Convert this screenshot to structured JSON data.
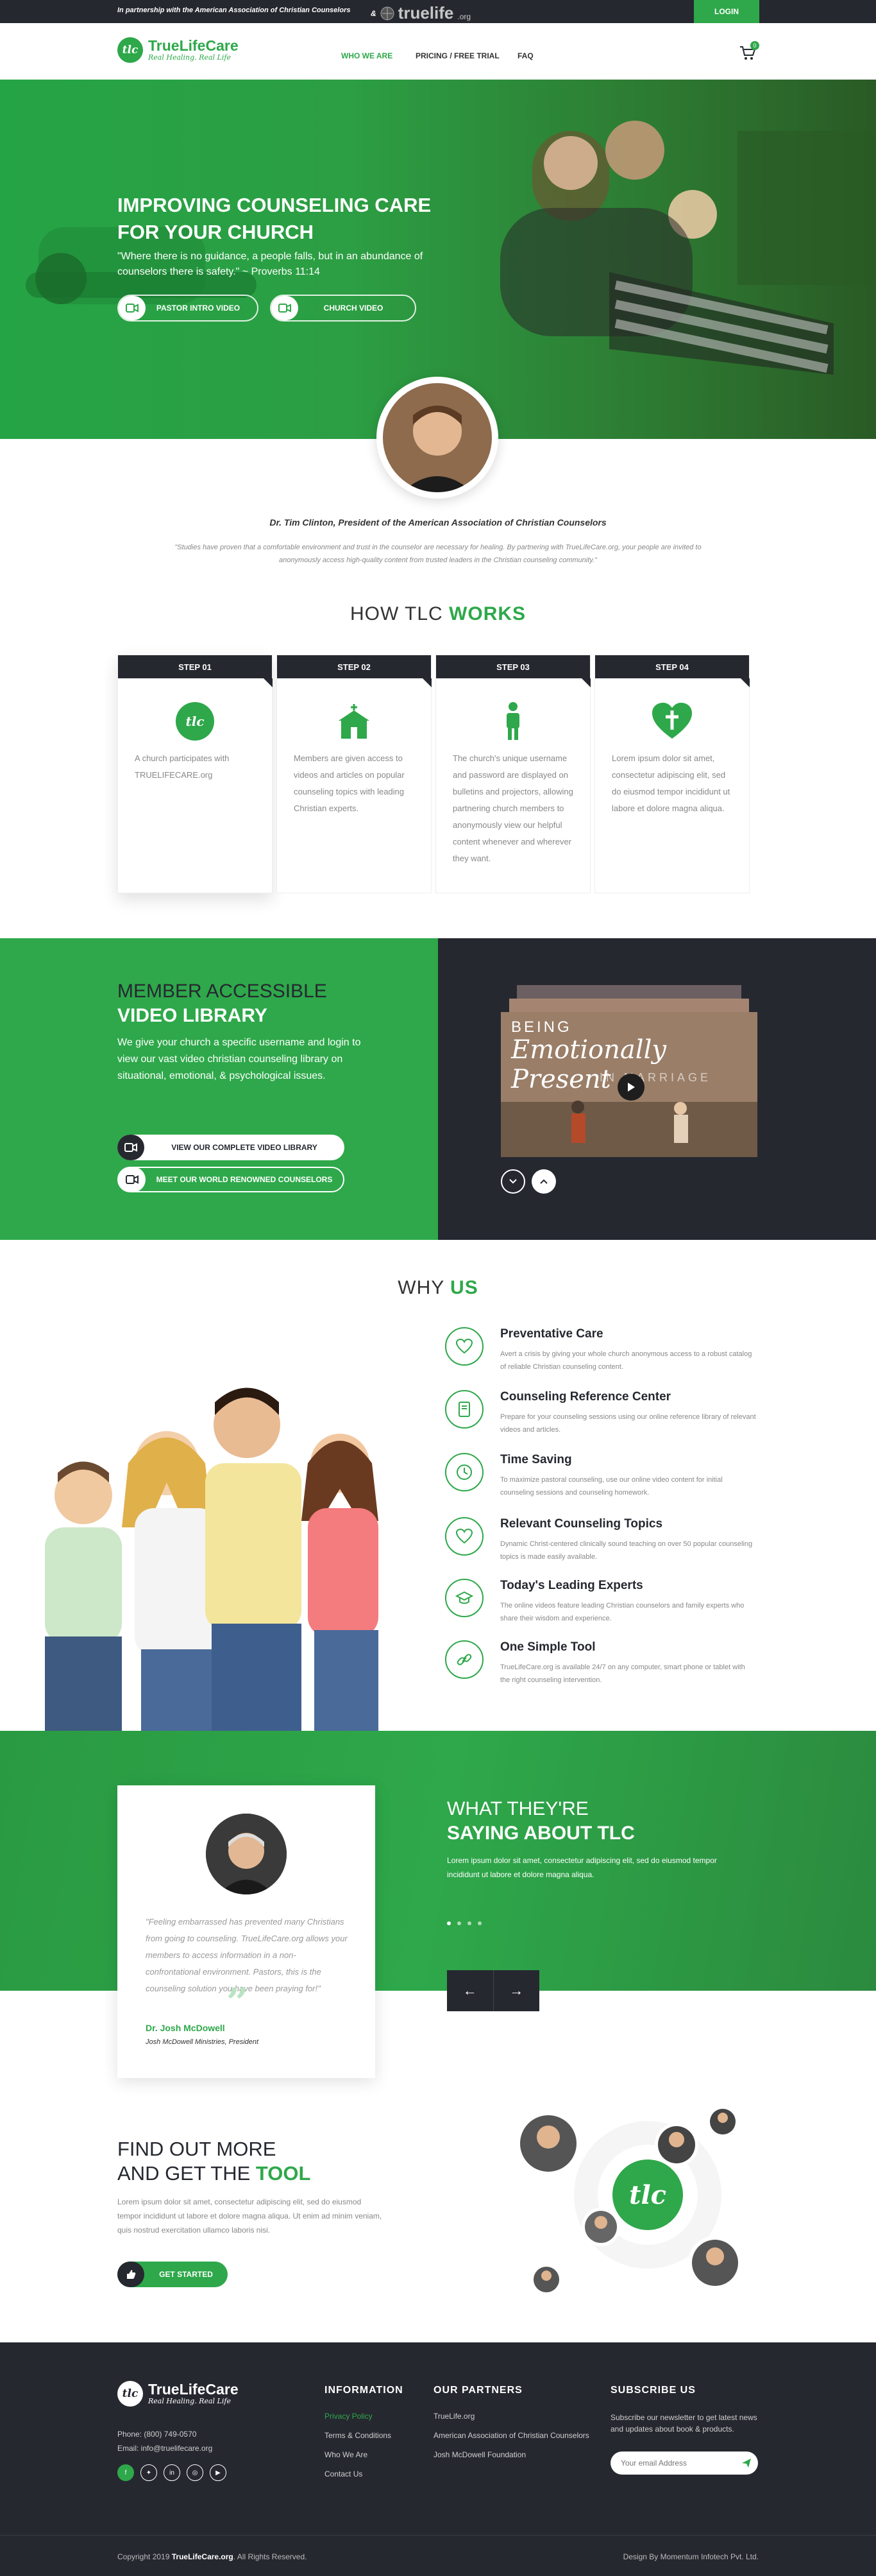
{
  "topbar": {
    "partner_text": "In partnership with the American Association of Christian Counselors",
    "amp": "&",
    "partner_logo": "truelife",
    "partner_logo_suffix": ".org",
    "login": "LOGIN"
  },
  "header": {
    "brand_name": "TrueLifeCare",
    "brand_tagline": "Real Healing. Real Life",
    "brand_badge": "tlc",
    "nav": [
      "WHO WE ARE",
      "PRICING / FREE TRIAL",
      "FAQ"
    ],
    "cart_count": "0",
    "active_nav_color": "#2ea84a"
  },
  "hero": {
    "title_line1": "IMPROVING COUNSELING CARE",
    "title_line2": "FOR YOUR CHURCH",
    "quote": "\"Where there is no guidance, a people falls, but in an abundance of counselors there is safety.\" ~ Proverbs 11:14",
    "btn_pastor": "PASTOR INTRO VIDEO",
    "btn_church": "CHURCH VIDEO"
  },
  "intro": {
    "name": "Dr. Tim Clinton, President of the American Association of Christian Counselors",
    "text": "\"Studies have proven that a comfortable environment and trust in the counselor are necessary for healing. By partnering with TrueLifeCare.org, your people are invited to anonymously access high-quality content from trusted leaders in the Christian counseling community.\""
  },
  "how": {
    "title_a": "HOW TLC ",
    "title_b": "WORKS",
    "steps": [
      {
        "label": "STEP 01",
        "icon": "tlc-badge-icon",
        "text": "A church participates with TRUELIFECARE.org"
      },
      {
        "label": "STEP 02",
        "icon": "church-icon",
        "text": "Members are given access to videos and articles on popular counseling topics with leading Christian experts."
      },
      {
        "label": "STEP 03",
        "icon": "person-icon",
        "text": "The church's unique username and password are displayed on bulletins and projectors, allowing partnering church members to anonymously view our helpful content whenever and wherever they want."
      },
      {
        "label": "STEP 04",
        "icon": "heart-cross-icon",
        "text": "Lorem ipsum dolor sit amet, consectetur adipiscing elit, sed do eiusmod tempor incididunt ut labore et dolore magna aliqua."
      }
    ]
  },
  "vlib": {
    "title_a": "MEMBER ACCESSIBLE",
    "title_b": "VIDEO LIBRARY",
    "text": "We give your church a specific username and login to view our vast video christian counseling library on situational, emotional, & psychological issues.",
    "btn_library": "VIEW OUR COMPLETE VIDEO LIBRARY",
    "btn_counselors": "MEET OUR WORLD RENOWNED COUNSELORS",
    "video_t1": "BEING",
    "video_t2": "Emotionally Present",
    "video_t3": "IN MARRIAGE"
  },
  "why": {
    "title_a": "WHY ",
    "title_b": "US",
    "items": [
      {
        "title": "Preventative Care",
        "icon": "heart-icon",
        "text": "Avert a crisis by giving your whole church anonymous access to a robust catalog of reliable Christian counseling content."
      },
      {
        "title": "Counseling Reference Center",
        "icon": "book-icon",
        "text": "Prepare for your counseling sessions using our online reference library of relevant videos and articles."
      },
      {
        "title": "Time Saving",
        "icon": "clock-icon",
        "text": "To maximize pastoral counseling, use our online video content for initial counseling sessions and counseling homework."
      },
      {
        "title": "Relevant Counseling Topics",
        "icon": "heart-outline-icon",
        "text": "Dynamic Christ-centered clinically sound teaching on over 50 popular counseling topics is made easily available."
      },
      {
        "title": "Today's Leading Experts",
        "icon": "graduation-cap-icon",
        "text": "The online videos feature leading Christian counselors and family experts who share their wisdom and experience."
      },
      {
        "title": "One Simple Tool",
        "icon": "link-icon",
        "text": "TrueLifeCare.org is available 24/7 on any computer, smart phone or tablet with the right counseling intervention."
      }
    ]
  },
  "testi": {
    "title_a": "WHAT THEY'RE",
    "title_b": "SAYING ABOUT TLC",
    "text": "Lorem ipsum dolor sit amet, consectetur adipiscing elit, sed do eiusmod tempor incididunt ut labore et dolore magna aliqua.",
    "quote": "\"Feeling embarrassed has prevented many Christians from going to counseling. TrueLifeCare.org allows your members to access information in a non-confrontational environment. Pastors, this is the counseling solution you have been praying for!\"",
    "name": "Dr. Josh McDowell",
    "role": "Josh McDowell Ministries, President",
    "prev": "←",
    "next": "→"
  },
  "fom": {
    "title_a": "FIND OUT MORE",
    "title_b": "AND GET THE ",
    "title_c": "TOOL",
    "text": "Lorem ipsum dolor sit amet, consectetur adipiscing elit, sed do eiusmod tempor incididunt ut labore et dolore magna aliqua. Ut enim ad minim veniam, quis nostrud exercitation ullamco laboris nisi.",
    "btn": "GET STARTED",
    "center_badge": "tlc"
  },
  "footer": {
    "brand_name": "TrueLifeCare",
    "brand_tagline": "Real Healing. Real Life",
    "phone": "Phone: (800) 749-0570",
    "email": "Email: info@truelifecare.org",
    "info_title": "INFORMATION",
    "info_links": [
      "Privacy Policy",
      "Terms & Conditions",
      "Who We Are",
      "Contact Us"
    ],
    "partners_title": "OUR PARTNERS",
    "partners_links": [
      "TrueLife.org",
      "American Association of Christian Counselors",
      "Josh McDowell Foundation"
    ],
    "sub_title": "SUBSCRIBE US",
    "sub_text": "Subscribe our newsletter to get latest news and updates about book & products.",
    "sub_placeholder": "Your email Address",
    "copyright_a": "Copyright 2019 ",
    "copyright_b": "TrueLifeCare.org",
    "copyright_c": ". All Rights Reserved.",
    "design": "Design By Momentum Infotech Pvt. Ltd."
  },
  "colors": {
    "accent": "#2ea84a",
    "dark": "#262830"
  }
}
